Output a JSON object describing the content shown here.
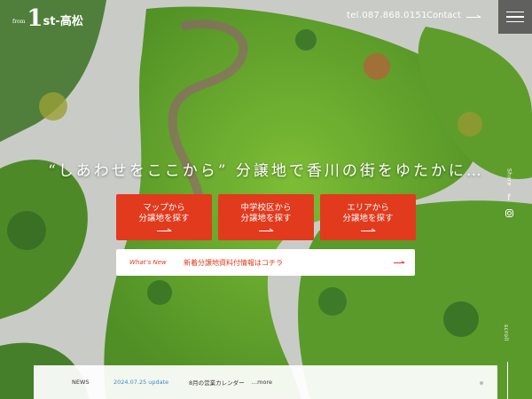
{
  "header": {
    "logo_from": "from",
    "logo_mark": "1",
    "logo_text": "st-高松",
    "tel": "tel.087.868.0151",
    "contact_label": "Contact"
  },
  "hero": {
    "headline": "“しあわせをここから” 分譲地で香川の街をゆたかに…"
  },
  "search_buttons": [
    {
      "label": "マップから\n分譲地を探す"
    },
    {
      "label": "中学校区から\n分譲地を探す"
    },
    {
      "label": "エリアから\n分譲地を探す"
    }
  ],
  "whats_new": {
    "tag": "What’s New",
    "text": "新着分譲地資料付情報はコチラ"
  },
  "share": {
    "label": "Share",
    "facebook_icon": "f"
  },
  "scroll_label": "scroll",
  "news": {
    "label": "NEWS",
    "date": "2024.07.25 update",
    "title": "8月の営業カレンダー",
    "more": "…more"
  },
  "colors": {
    "accent_red": "#e23a1d",
    "news_date_blue": "#3d8bc9",
    "grass": "#6fae2e",
    "path": "#d9dcd6"
  }
}
